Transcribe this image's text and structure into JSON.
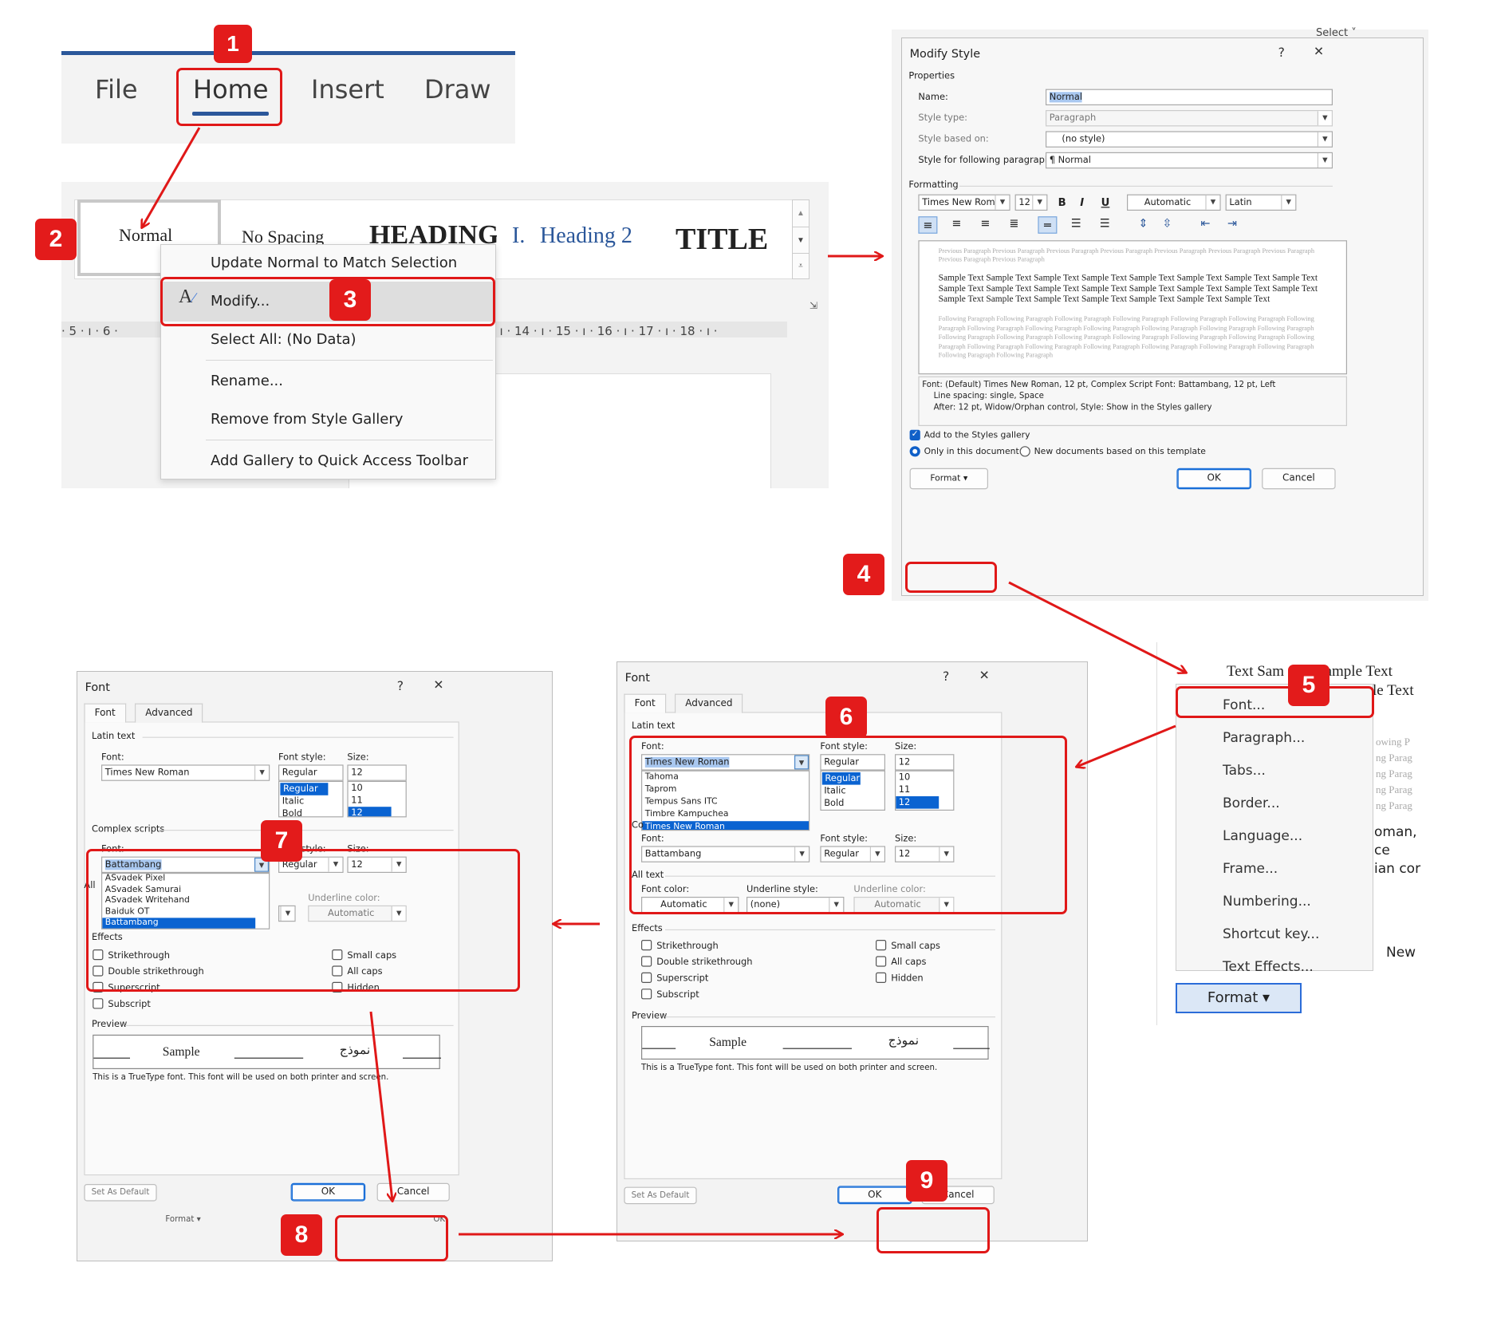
{
  "steps": [
    "1",
    "2",
    "3",
    "4",
    "5",
    "6",
    "7",
    "8",
    "9"
  ],
  "ribbon": {
    "tabs": [
      "File",
      "Home",
      "Insert",
      "Draw"
    ]
  },
  "styles_gallery": {
    "items": [
      "Normal",
      "No Spacing",
      "HEADING",
      "I.",
      "Heading 2",
      "TITLE"
    ],
    "ruler": "· 5 · ı · 6 ·",
    "ruler2": "· ı · 14 · ı · 15 · ı · 16 · ı · 17 · ı · 18 · ı ·"
  },
  "context_menu": {
    "items": [
      "Update Normal to Match Selection",
      "Modify...",
      "Select All: (No Data)",
      "Rename...",
      "Remove from Style Gallery",
      "Add Gallery to Quick Access Toolbar"
    ]
  },
  "modify_style": {
    "title": "Modify Style",
    "help": "?",
    "close": "✕",
    "select_label": "Select ˅",
    "properties_label": "Properties",
    "name_label": "Name:",
    "name_value": "Normal",
    "style_type_label": "Style type:",
    "style_type_value": "Paragraph",
    "based_on_label": "Style based on:",
    "based_on_value": "(no style)",
    "following_label": "Style for following paragraph:",
    "following_value": "¶ Normal",
    "formatting_label": "Formatting",
    "font": "Times New Roman",
    "size": "12",
    "bold": "B",
    "italic": "I",
    "underline": "U",
    "color": "Automatic",
    "script": "Latin",
    "prev_para": "Previous Paragraph Previous Paragraph Previous Paragraph Previous Paragraph Previous Paragraph Previous Paragraph Previous Paragraph Previous Paragraph Previous Paragraph",
    "sample_text": "Sample Text Sample Text Sample Text Sample Text Sample Text Sample Text Sample Text Sample Text Sample Text Sample Text Sample Text Sample Text Sample Text Sample Text Sample Text Sample Text Sample Text Sample Text Sample Text Sample Text Sample Text Sample Text Sample Text",
    "follow_para": "Following Paragraph Following Paragraph Following Paragraph Following Paragraph Following Paragraph Following Paragraph Following Paragraph Following Paragraph Following Paragraph Following Paragraph Following Paragraph Following Paragraph Following Paragraph Following Paragraph Following Paragraph Following Paragraph Following Paragraph Following Paragraph Following Paragraph Following Paragraph Following Paragraph Following Paragraph Following Paragraph Following Paragraph Following Paragraph Following Paragraph Following Paragraph Following Paragraph",
    "desc1": "Font: (Default) Times New Roman, 12 pt, Complex Script Font: Battambang, 12 pt, Left",
    "desc2": "Line spacing:  single, Space",
    "desc3": "After:  12 pt, Widow/Orphan control, Style: Show in the Styles gallery",
    "add_gallery": "Add to the Styles gallery",
    "only_doc": "Only in this document",
    "new_docs": "New documents based on this template",
    "format_btn": "Format ▾",
    "ok": "OK",
    "cancel": "Cancel"
  },
  "format_menu": {
    "items": [
      "Font...",
      "Paragraph...",
      "Tabs...",
      "Border...",
      "Language...",
      "Frame...",
      "Numbering...",
      "Shortcut key...",
      "Text Effects..."
    ],
    "button": "Format ▾",
    "bg_lines": [
      "Text Sam",
      "t Sample Text",
      "le Text",
      "owing P",
      "ng Parag",
      "ng Parag",
      "ng Parag",
      "ng Parag",
      "oman,",
      "ce",
      "ian cor",
      "New"
    ]
  },
  "font_dialog_right": {
    "title": "Font",
    "help": "?",
    "close": "✕",
    "tab_font": "Font",
    "tab_advanced": "Advanced",
    "latin_label": "Latin text",
    "font_label": "Font:",
    "font_value": "Times New Roman",
    "font_list": [
      "Tahoma",
      "Taprom",
      "Tempus Sans ITC",
      "Timbre Kampuchea",
      "Times New Roman"
    ],
    "style_label": "Font style:",
    "style_value": "Regular",
    "style_list": [
      "Regular",
      "Italic",
      "Bold"
    ],
    "size_label": "Size:",
    "size_value": "12",
    "size_list": [
      "10",
      "11",
      "12"
    ],
    "cs_font_label": "Font:",
    "cs_font_value": "Battambang",
    "cs_style_label": "Font style:",
    "cs_style_value": "Regular",
    "cs_size_label": "Size:",
    "cs_size_value": "12",
    "cs_partial": "Co",
    "all_text": "All text",
    "font_color_label": "Font color:",
    "font_color_value": "Automatic",
    "underline_style_label": "Underline style:",
    "underline_style_value": "(none)",
    "underline_color_label": "Underline color:",
    "underline_color_value": "Automatic",
    "effects_label": "Effects",
    "effects_left": [
      "Strikethrough",
      "Double strikethrough",
      "Superscript",
      "Subscript"
    ],
    "effects_right": [
      "Small caps",
      "All caps",
      "Hidden"
    ],
    "preview_label": "Preview",
    "preview_sample": "Sample",
    "preview_arabic": "نموذج",
    "truetype": "This is a TrueType font. This font will be used on both printer and screen.",
    "set_default": "Set As Default",
    "ok": "OK",
    "cancel": "Cancel"
  },
  "font_dialog_left": {
    "title": "Font",
    "help": "?",
    "close": "✕",
    "tab_font": "Font",
    "tab_advanced": "Advanced",
    "latin_label": "Latin text",
    "font_label": "Font:",
    "font_value": "Times New Roman",
    "style_label": "Font style:",
    "style_value": "Regular",
    "style_list": [
      "Regular",
      "Italic",
      "Bold"
    ],
    "size_label": "Size:",
    "size_value": "12",
    "size_list": [
      "10",
      "11",
      "12"
    ],
    "cs_label": "Complex scripts",
    "cs_font_label": "Font:",
    "cs_font_value": "Battambang",
    "cs_font_list": [
      "ASvadek Pixel",
      "ASvadek Samurai",
      "ASvadek Writehand",
      "Baiduk OT",
      "Battambang"
    ],
    "cs_style_label": "Font style:",
    "cs_style_value": "Regular",
    "cs_size_label": "Size:",
    "cs_size_value": "12",
    "all_partial": "All",
    "underline_color_label": "Underline color:",
    "underline_color_value": "Automatic",
    "effects_label": "Effects",
    "effects_left": [
      "Strikethrough",
      "Double strikethrough",
      "Superscript",
      "Subscript"
    ],
    "effects_right": [
      "Small caps",
      "All caps",
      "Hidden"
    ],
    "preview_label": "Preview",
    "preview_sample": "Sample",
    "preview_arabic": "نموذج",
    "truetype": "This is a TrueType font. This font will be used on both printer and screen.",
    "set_default": "Set As Default",
    "ok": "OK",
    "cancel": "Cancel",
    "format_partial": "Format ▾",
    "ok_partial": "OK"
  },
  "colors": {
    "accent_red": "#e31b1b",
    "selection_blue": "#0a63d1",
    "word_blue": "#2b579a"
  }
}
